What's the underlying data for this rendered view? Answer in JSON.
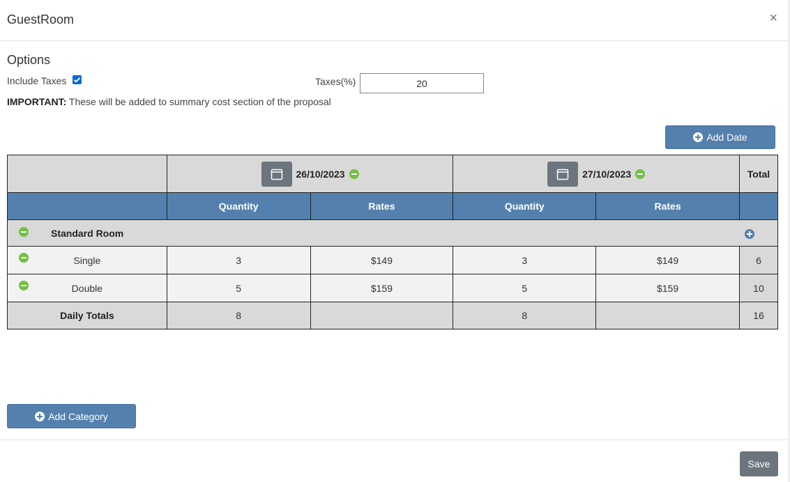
{
  "modal": {
    "title": "GuestRoom",
    "close": "×"
  },
  "options": {
    "title": "Options",
    "include_taxes_label": "Include Taxes",
    "include_taxes_checked": true,
    "taxes_label": "Taxes(%)",
    "taxes_value": "20",
    "important_label": "IMPORTANT:",
    "important_text": " These will be added to summary cost section of the proposal"
  },
  "add_date_label": "Add Date",
  "table": {
    "dates": [
      "26/10/2023",
      "27/10/2023"
    ],
    "total_header": "Total",
    "sub_headers": [
      "Quantity",
      "Rates",
      "Quantity",
      "Rates"
    ],
    "category": "Standard Room",
    "rows": [
      {
        "label": "Single",
        "cells": [
          "3",
          "$149",
          "3",
          "$149"
        ],
        "total": "6"
      },
      {
        "label": "Double",
        "cells": [
          "5",
          "$159",
          "5",
          "$159"
        ],
        "total": "10"
      }
    ],
    "totals": {
      "label": "Daily Totals",
      "cells": [
        "8",
        "",
        "8",
        ""
      ],
      "total": "16"
    }
  },
  "add_category_label": "Add Category",
  "save_label": "Save",
  "colors": {
    "primary": "#5480ad",
    "secondary": "#6c757d",
    "success": "#72c043",
    "checkbox": "#0a6ed1"
  }
}
